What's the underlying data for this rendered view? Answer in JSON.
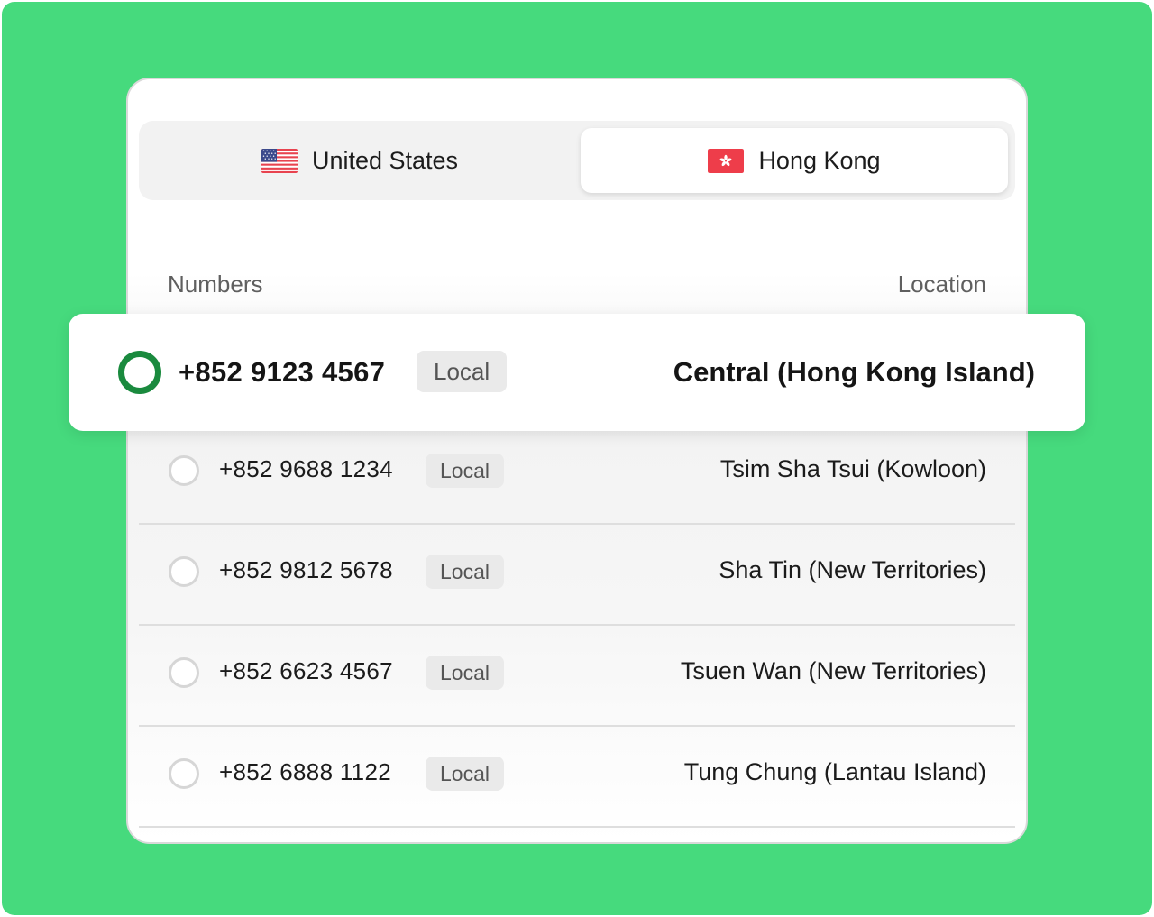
{
  "colors": {
    "background": "#46da7d",
    "selected_radio": "#1a8a3e",
    "hk_flag": "#ee3d4a"
  },
  "tabs": [
    {
      "label": "United States",
      "flag_icon": "us-flag-icon",
      "active": false
    },
    {
      "label": "Hong Kong",
      "flag_icon": "hk-flag-icon",
      "active": true
    }
  ],
  "table": {
    "headers": {
      "numbers": "Numbers",
      "location": "Location"
    },
    "selected_row": {
      "number": "+852 9123 4567",
      "type": "Local",
      "location": "Central (Hong Kong Island)",
      "selected": true
    },
    "rows": [
      {
        "number": "+852 9688 1234",
        "type": "Local",
        "location": "Tsim Sha Tsui (Kowloon)",
        "selected": false
      },
      {
        "number": "+852 9812 5678",
        "type": "Local",
        "location": "Sha Tin (New Territories)",
        "selected": false
      },
      {
        "number": "+852 6623 4567",
        "type": "Local",
        "location": "Tsuen Wan (New Territories)",
        "selected": false
      },
      {
        "number": "+852 6888 1122",
        "type": "Local",
        "location": "Tung Chung (Lantau Island)",
        "selected": false
      }
    ]
  }
}
